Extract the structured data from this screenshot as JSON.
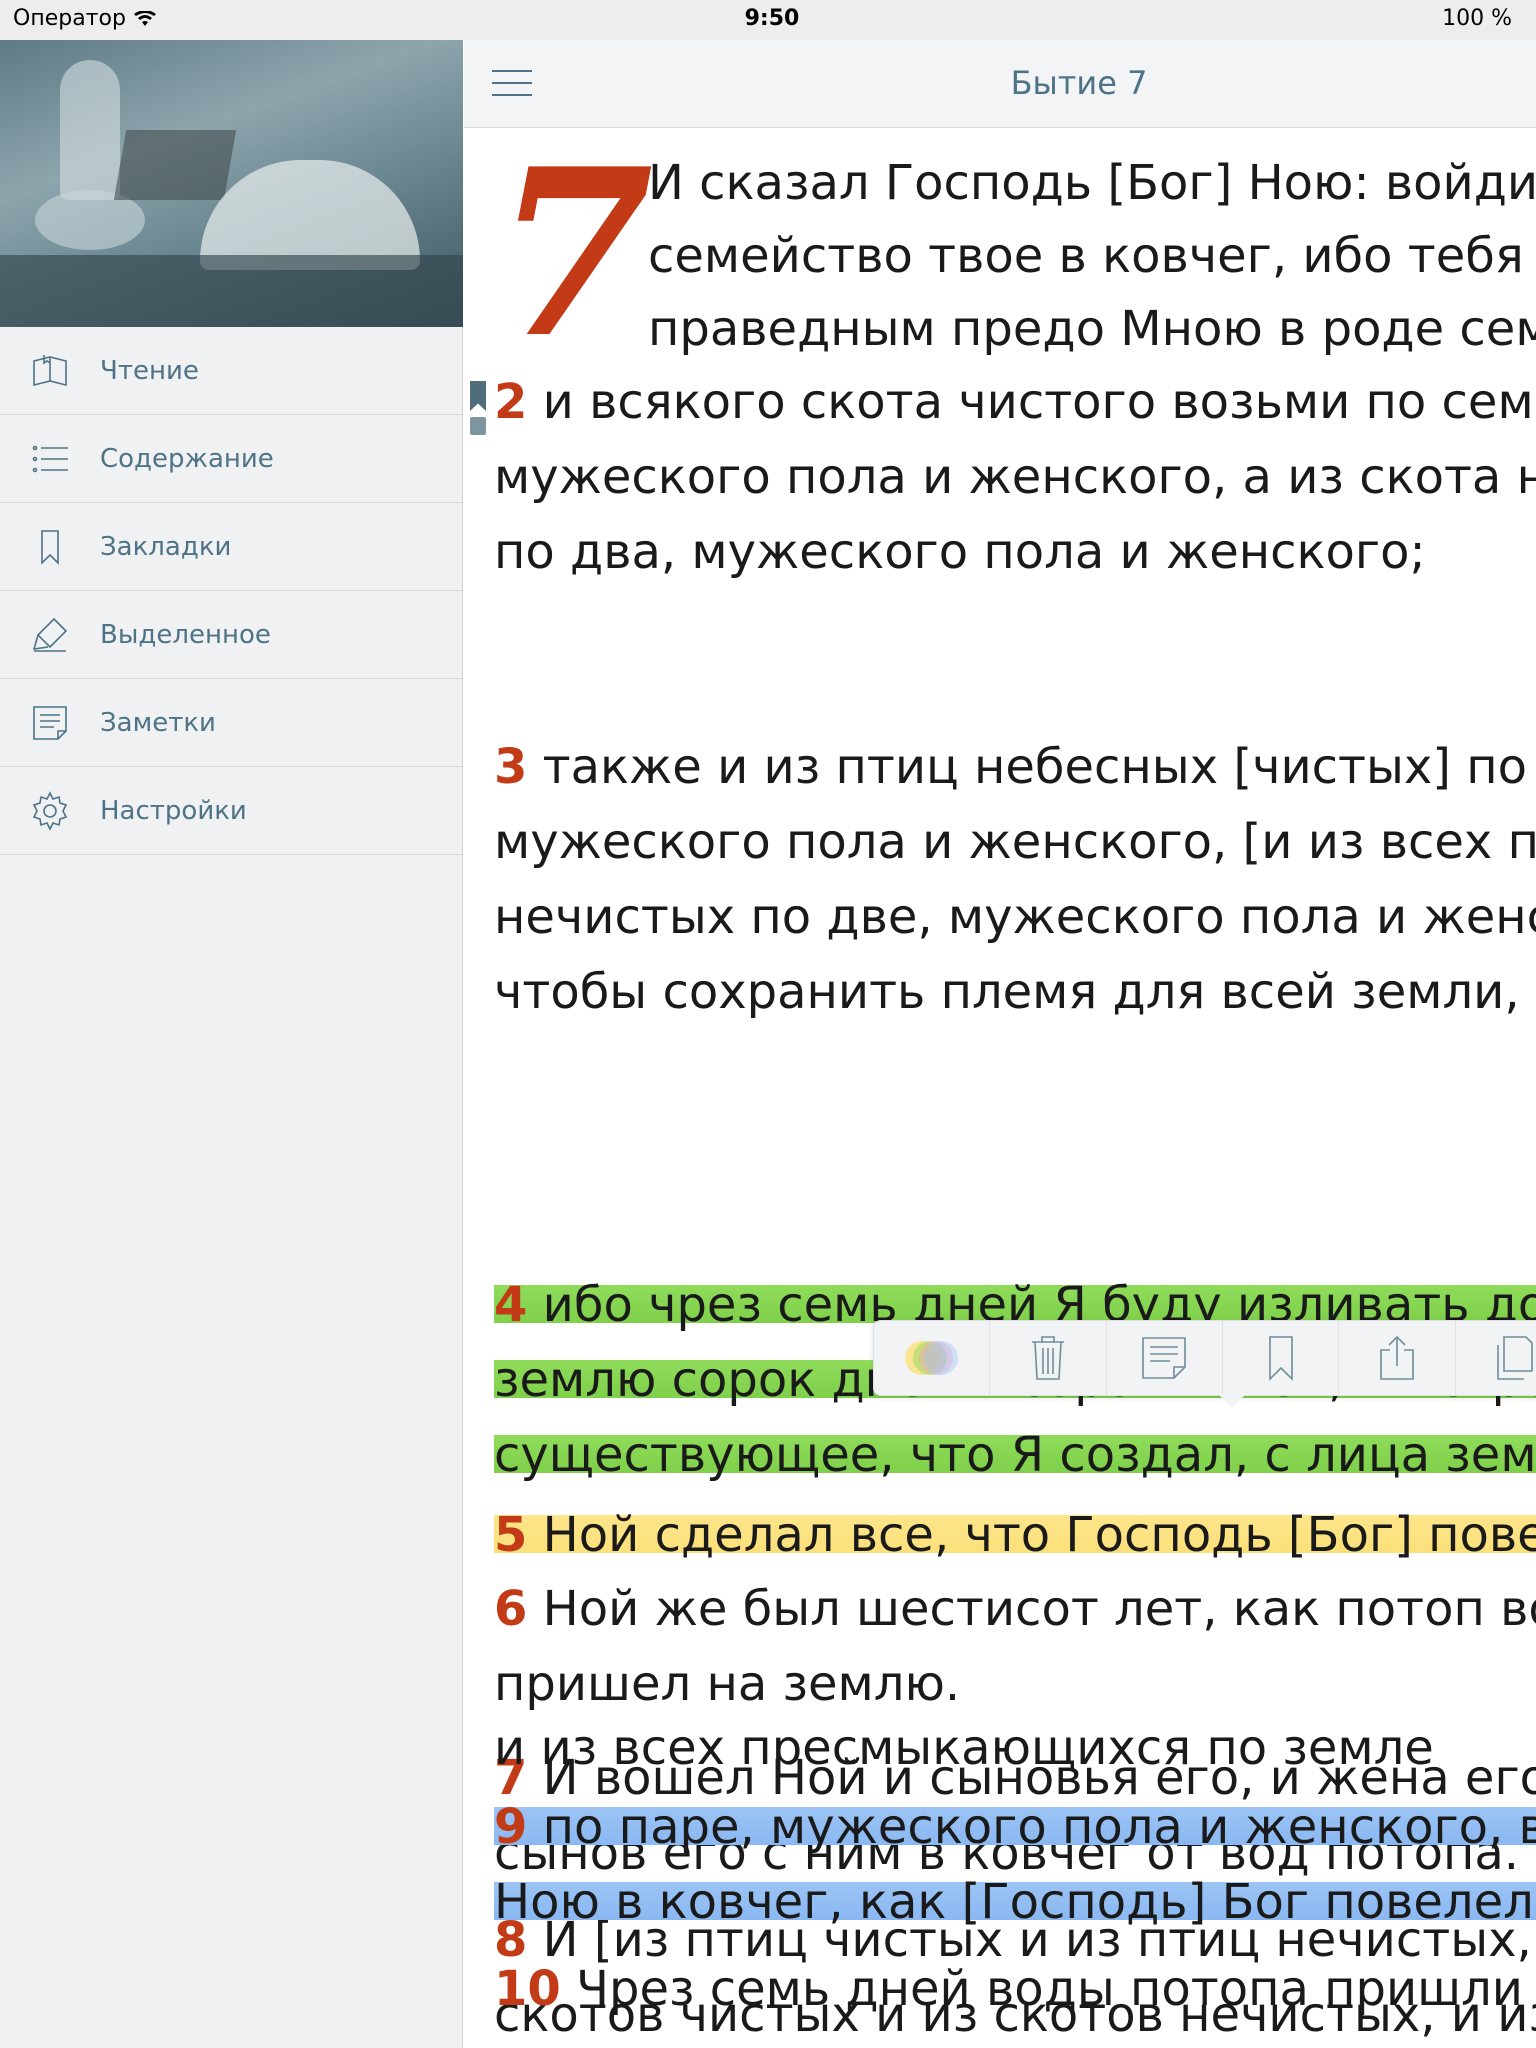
{
  "status_bar": {
    "carrier": "Оператор",
    "time": "9:50",
    "battery": "100 %"
  },
  "sidebar": {
    "items": [
      {
        "label": "Чтение",
        "icon": "open-book-icon"
      },
      {
        "label": "Содержание",
        "icon": "list-icon"
      },
      {
        "label": "Закладки",
        "icon": "bookmark-icon"
      },
      {
        "label": "Выделенное",
        "icon": "highlighter-icon"
      },
      {
        "label": "Заметки",
        "icon": "note-icon"
      },
      {
        "label": "Настройки",
        "icon": "gear-icon"
      }
    ]
  },
  "navbar": {
    "title": "Бытие 7"
  },
  "reader": {
    "chapter_number": "7",
    "verse1_lines": [
      "И сказал Господь [Бог] Ною: войди ты и все",
      "семейство твое в ковчег, ибо тебя увидел Я",
      "праведным предо Мною в роде сем;"
    ],
    "verses": [
      {
        "num": "2",
        "lines": [
          "и всякого скота чистого возьми по семи,",
          "мужеского пола и женского, а из скота нечистого",
          "по два, мужеского пола и женского;"
        ]
      },
      {
        "num": "3",
        "lines": [
          "также и из птиц небесных [чистых] по семи,",
          "мужеского пола и женского, [и из всех птиц",
          "нечистых по две, мужеского пола и женского,]",
          "чтобы сохранить племя для всей земли,"
        ]
      },
      {
        "num": "4",
        "lines": [
          "ибо чрез семь дней Я буду изливать дождь на",
          "землю сорок дней и сорок ночей; и истреблю все",
          "существующее, что Я создал, с лица земли."
        ],
        "highlight": "green"
      },
      {
        "num": "5",
        "lines": [
          "Ной сделал все, что Господь [Бог] повелел ему."
        ],
        "highlight": "yellow"
      },
      {
        "num": "6",
        "lines": [
          "Ной же был шестисот лет, как потоп водный",
          "пришел на землю."
        ]
      },
      {
        "num": "7",
        "lines": [
          "И вошел Ной и сыновья его, и жена его, и жены",
          "сынов его с ним в ковчег от вод потопа."
        ]
      },
      {
        "num": "8",
        "lines": [
          "И [из птиц чистых и из птиц нечистых, и из",
          "скотов чистых и из скотов нечистых, и из зверей]",
          "и из всех пресмыкающихся по земле"
        ]
      },
      {
        "num": "9",
        "lines": [
          "по паре, мужеского пола и женского, вошли к",
          "Ною в ковчег, как [Господь] Бог повелел Ною."
        ],
        "highlight": "blue"
      },
      {
        "num": "10",
        "lines": [
          "Чрез семь дней воды потопа пришли на землю."
        ]
      }
    ]
  },
  "popup": {
    "buttons": [
      "color-picker-icon",
      "trash-icon",
      "note-icon",
      "bookmark-icon",
      "share-icon",
      "copy-icon"
    ]
  }
}
